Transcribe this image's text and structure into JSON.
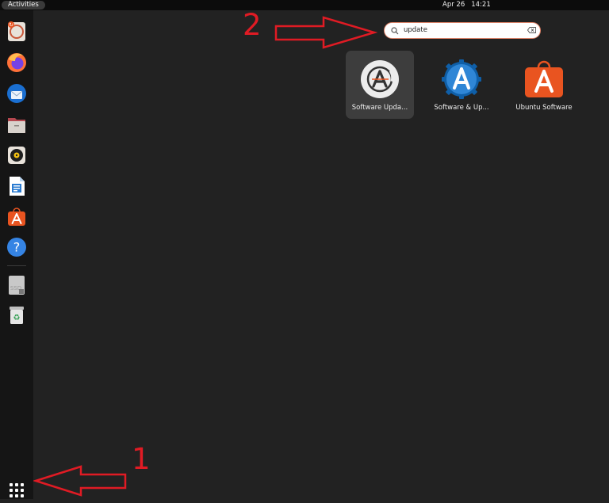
{
  "topbar": {
    "activities_label": "Activities",
    "date": "Apr 26",
    "time": "14:21"
  },
  "dock": {
    "items": [
      {
        "name": "software-updater-app-icon"
      },
      {
        "name": "firefox-icon"
      },
      {
        "name": "thunderbird-icon"
      },
      {
        "name": "files-icon"
      },
      {
        "name": "rhythmbox-icon"
      },
      {
        "name": "libreoffice-writer-icon"
      },
      {
        "name": "ubuntu-software-icon"
      },
      {
        "name": "help-icon"
      },
      {
        "name": "ssd-drive-icon"
      },
      {
        "name": "trash-icon"
      }
    ],
    "show_apps_icon": "app-grid-icon"
  },
  "search": {
    "value": "update"
  },
  "results": [
    {
      "label": "Software Upda...",
      "icon": "software-updater-icon",
      "selected": true
    },
    {
      "label": "Software & Up...",
      "icon": "software-and-updates-icon",
      "selected": false
    },
    {
      "label": "Ubuntu Software",
      "icon": "ubuntu-software-icon",
      "selected": false
    }
  ],
  "annotations": [
    {
      "label": "1",
      "color": "#e01b24"
    },
    {
      "label": "2",
      "color": "#e01b24"
    }
  ],
  "colors": {
    "background": "#222222",
    "dock": "#151515",
    "topbar": "#0c0c0c",
    "annotation": "#e01b24",
    "ubuntu_orange": "#e95420",
    "search_focus": "#e2856a"
  }
}
